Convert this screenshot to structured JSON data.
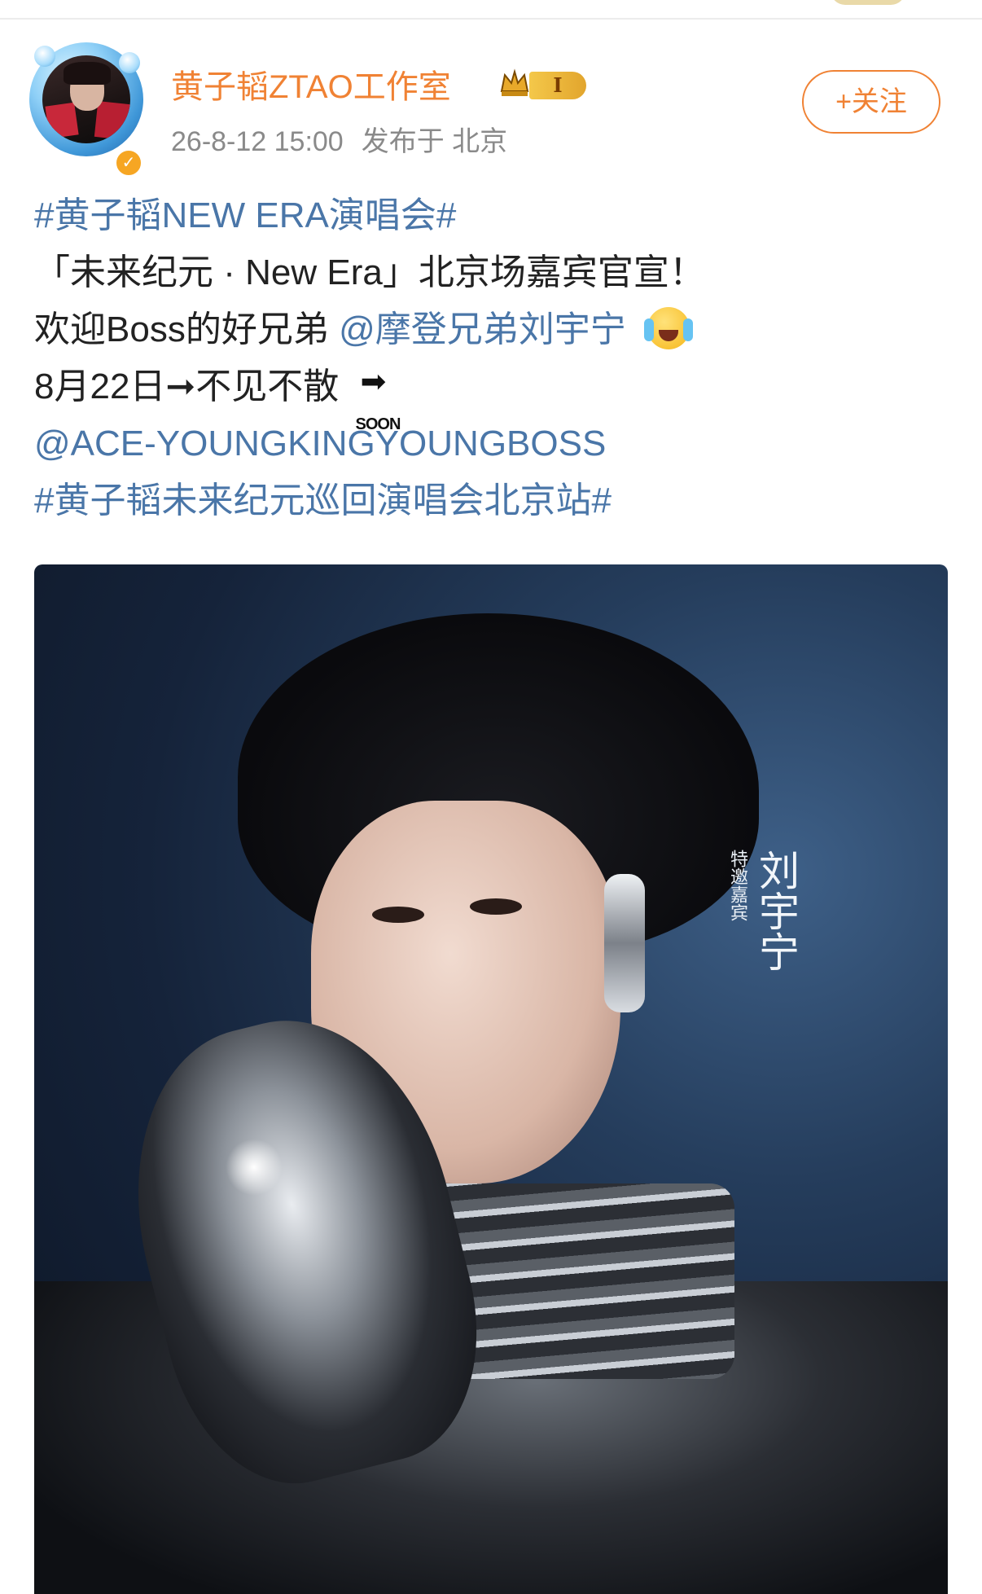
{
  "post": {
    "author": {
      "name": "黄子韬ZTAO工作室",
      "vip_level": "I"
    },
    "meta": {
      "time": "26-8-12 15:00",
      "location": "发布于 北京"
    },
    "follow_label": "+关注",
    "lines": {
      "hashtag1": "#黄子韬NEW ERA演唱会#",
      "line2": "「未来纪元 · New Era」北京场嘉宾官宣！",
      "line3_prefix": "欢迎Boss的好兄弟",
      "mention1": "@摩登兄弟刘宇宁",
      "line4_prefix": "8月22日➞不见不散",
      "soon_label": "SOON",
      "mention2": "@ACE-YOUNGKINGYOUNGBOSS",
      "hashtag2": "#黄子韬未来纪元巡回演唱会北京站#"
    },
    "image": {
      "guest_label": "特邀嘉宾",
      "guest_name": "刘宇宁"
    }
  },
  "icons": [
    "crown-icon",
    "verified-icon",
    "crying-laughing-emoji-icon",
    "soon-arrow-icon"
  ],
  "colors": {
    "username": "#f08234",
    "link": "#4a76a8",
    "text": "#222222",
    "meta": "#8a8a8a"
  }
}
